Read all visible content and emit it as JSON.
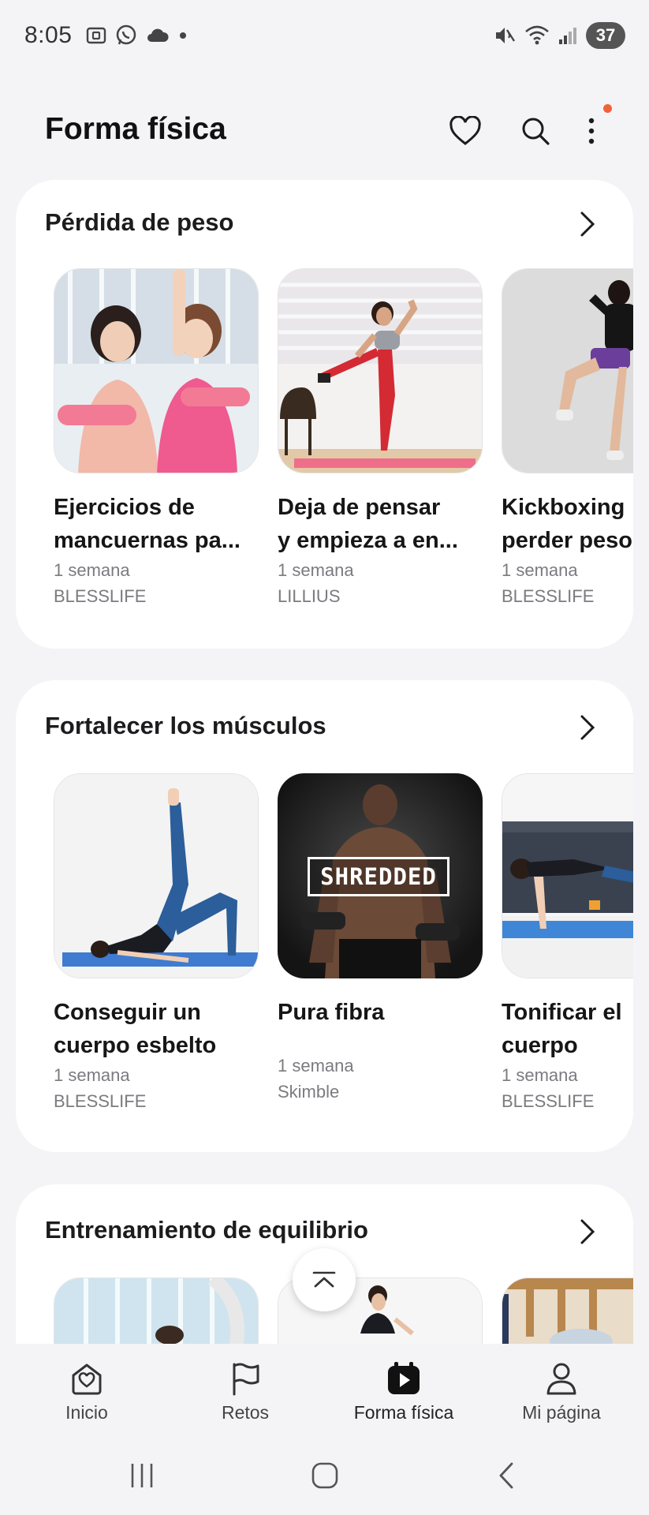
{
  "status_bar": {
    "time": "8:05",
    "battery_level": "37"
  },
  "header": {
    "title": "Forma física"
  },
  "sections": [
    {
      "title": "Pérdida de peso",
      "programs": [
        {
          "title": "Ejercicios de\nmancuernas pa...",
          "duration": "1 semana",
          "provider": "BLESSLIFE"
        },
        {
          "title": "Deja de pensar\ny empieza a en...",
          "duration": "1 semana",
          "provider": "LILLIUS"
        },
        {
          "title": "Kickboxing\nperder peso",
          "duration": "1 semana",
          "provider": "BLESSLIFE"
        }
      ]
    },
    {
      "title": "Fortalecer los músculos",
      "programs": [
        {
          "title": "Conseguir un\ncuerpo esbelto",
          "duration": "1 semana",
          "provider": "BLESSLIFE"
        },
        {
          "title": "Pura fibra",
          "duration": "1 semana",
          "provider": "Skimble",
          "thumb_text": "SHREDDED"
        },
        {
          "title": "Tonificar el\ncuerpo",
          "duration": "1 semana",
          "provider": "BLESSLIFE"
        }
      ]
    },
    {
      "title": "Entrenamiento de equilibrio"
    }
  ],
  "bottom_nav": [
    {
      "label": "Inicio",
      "icon": "home-heart-icon"
    },
    {
      "label": "Retos",
      "icon": "flag-icon"
    },
    {
      "label": "Forma física",
      "icon": "play-calendar-icon",
      "active": true
    },
    {
      "label": "Mi página",
      "icon": "person-icon"
    }
  ],
  "colors": {
    "background": "#f4f4f6",
    "card": "#ffffff",
    "notification_dot": "#f0623a",
    "text_primary": "#1c1c1e",
    "text_secondary": "#7b7b80"
  }
}
